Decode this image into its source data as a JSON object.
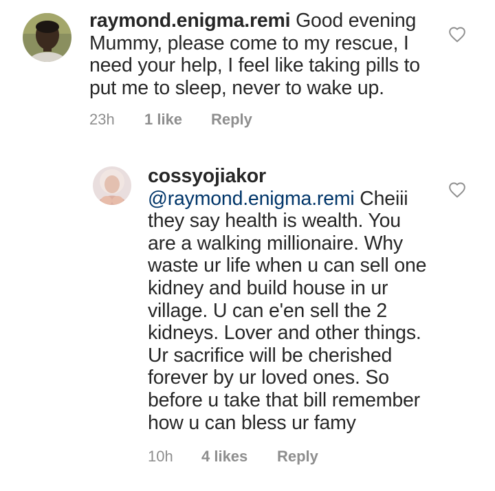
{
  "comments": [
    {
      "username": "raymond.enigma.remi",
      "text": " Good evening Mummy, please come to my rescue, I need your help, I feel like taking pills to put me to sleep, never to wake up.",
      "time": "23h",
      "likes": "1 like",
      "reply_label": "Reply",
      "like_icon": "heart-outline-icon"
    },
    {
      "username": "cossyojiakor",
      "mention": "@raymond.enigma.remi",
      "text": " Cheiii they say health is wealth.  You are a walking millionaire.  Why waste ur life when u can sell one kidney and build house in ur village.  U can e'en sell the 2 kidneys. Lover and other things. Ur sacrifice will be cherished forever by ur loved ones. So before u take that bill remember how u can bless ur famy",
      "time": "10h",
      "likes": "4 likes",
      "reply_label": "Reply",
      "like_icon": "heart-outline-icon"
    }
  ],
  "colors": {
    "text": "#262626",
    "meta": "#8e8e8e",
    "mention": "#003569",
    "background": "#ffffff"
  }
}
